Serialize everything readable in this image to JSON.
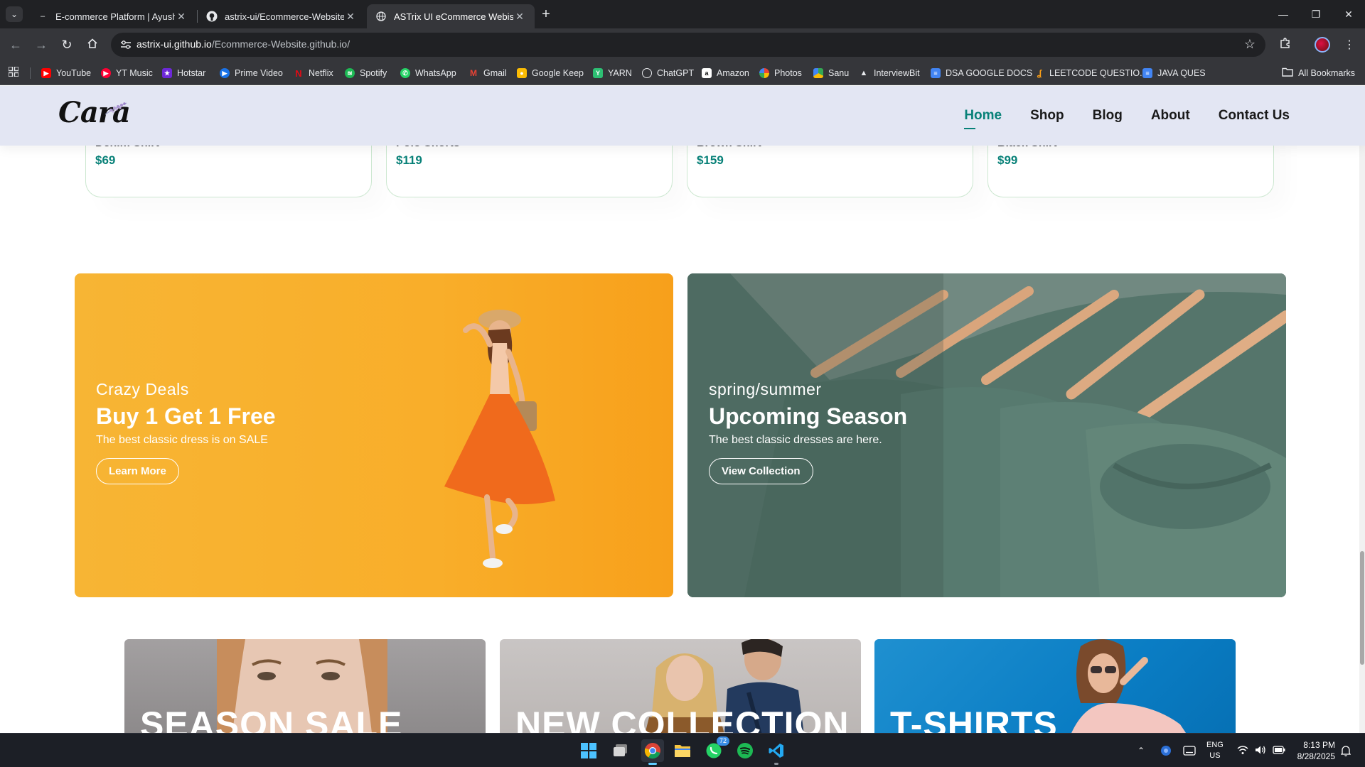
{
  "browser": {
    "tabs": [
      {
        "title": "E-commerce Platform | Ayush S",
        "favicon": "dash-icon",
        "active": false
      },
      {
        "title": "astrix-ui/Ecommerce-Website.g",
        "favicon": "github-icon",
        "active": false
      },
      {
        "title": "ASTrix UI eCommerce Webiste",
        "favicon": "globe-icon",
        "active": true
      }
    ],
    "url_host": "astrix-ui.github.io",
    "url_path": "/Ecommerce-Website.github.io/",
    "bookmarks": [
      {
        "label": "YouTube",
        "color": "#ff0000"
      },
      {
        "label": "YT Music",
        "color": "#ff0033"
      },
      {
        "label": "Hotstar",
        "color": "#6d28d9"
      },
      {
        "label": "Prime Video",
        "color": "#1a73e8"
      },
      {
        "label": "Netflix",
        "color": "#e50914"
      },
      {
        "label": "Spotify",
        "color": "#1db954"
      },
      {
        "label": "WhatsApp",
        "color": "#25d366"
      },
      {
        "label": "Gmail",
        "color": "#ea4335"
      },
      {
        "label": "Google Keep",
        "color": "#fbbc04"
      },
      {
        "label": "YARN",
        "color": "#2dbf73"
      },
      {
        "label": "ChatGPT",
        "color": "#74aa9c"
      },
      {
        "label": "Amazon",
        "color": "#ffffff"
      },
      {
        "label": "Photos",
        "color": "#fbbc04"
      },
      {
        "label": "Sanu",
        "color": "#34a853"
      },
      {
        "label": "InterviewBit",
        "color": "#9aa0a6"
      },
      {
        "label": "DSA GOOGLE DOCS",
        "color": "#4285f4"
      },
      {
        "label": "LEETCODE QUESTIO...",
        "color": "#ffa116"
      },
      {
        "label": "JAVA QUES",
        "color": "#4285f4"
      }
    ],
    "all_bookmarks": "All Bookmarks"
  },
  "site": {
    "logo": "Cara",
    "nav": [
      "Home",
      "Shop",
      "Blog",
      "About",
      "Contact Us"
    ],
    "active_nav": "Home",
    "products": [
      {
        "name": "Denim Shirt",
        "price": "$69"
      },
      {
        "name": "Polo Shorts",
        "price": "$119"
      },
      {
        "name": "Brown Shirt",
        "price": "$159"
      },
      {
        "name": "Black Shirt",
        "price": "$99"
      }
    ],
    "banners": [
      {
        "subtitle": "Crazy Deals",
        "title": "Buy 1 Get 1 Free",
        "desc": "The best classic dress is on SALE",
        "button": "Learn More"
      },
      {
        "subtitle": "spring/summer",
        "title": "Upcoming Season",
        "desc": "The best classic dresses are here.",
        "button": "View Collection"
      }
    ],
    "mini_banners": [
      {
        "title": "SEASON SALE"
      },
      {
        "title": "NEW COLLECTION"
      },
      {
        "title": "T-SHIRTS"
      }
    ],
    "colors": {
      "accent": "#088178",
      "header_bg": "#e3e6f3"
    }
  },
  "taskbar": {
    "whatsapp_badge": "72",
    "lang": "ENG",
    "region": "US",
    "time": "8:13 PM",
    "date": "8/28/2025"
  }
}
